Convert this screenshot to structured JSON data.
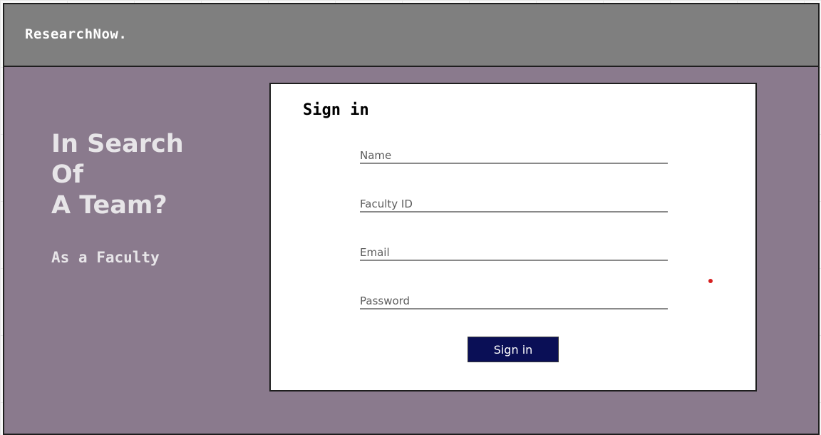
{
  "header": {
    "logo": "ResearchNow."
  },
  "hero": {
    "lines": [
      "In Search",
      "Of",
      "A Team?"
    ],
    "subtitle": "As a Faculty"
  },
  "signin": {
    "title": "Sign in",
    "fields": [
      {
        "label": "Name"
      },
      {
        "label": "Faculty ID"
      },
      {
        "label": "Email"
      },
      {
        "label": "Password"
      }
    ],
    "button_label": "Sign in"
  },
  "colors": {
    "background": "#8a7a8d",
    "header": "#7f7f7f",
    "button": "#0a0f56",
    "marker": "#d62020"
  }
}
